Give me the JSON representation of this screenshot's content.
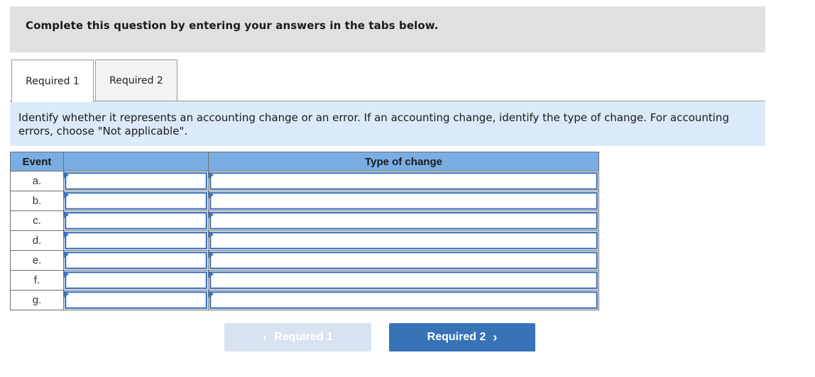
{
  "banner": {
    "text": "Complete this question by entering your answers in the tabs below."
  },
  "tabs": [
    {
      "label": "Required 1",
      "active": true
    },
    {
      "label": "Required 2",
      "active": false
    }
  ],
  "instructions": "Identify whether it represents an accounting change or an error. If an accounting change, identify the type of change. For accounting errors, choose \"Not applicable\".",
  "table": {
    "headers": [
      "Event",
      "",
      "Type of change"
    ],
    "rows": [
      {
        "event": "a.",
        "classification": "",
        "type_of_change": ""
      },
      {
        "event": "b.",
        "classification": "",
        "type_of_change": ""
      },
      {
        "event": "c.",
        "classification": "",
        "type_of_change": ""
      },
      {
        "event": "d.",
        "classification": "",
        "type_of_change": ""
      },
      {
        "event": "e.",
        "classification": "",
        "type_of_change": ""
      },
      {
        "event": "f.",
        "classification": "",
        "type_of_change": ""
      },
      {
        "event": "g.",
        "classification": "",
        "type_of_change": ""
      }
    ]
  },
  "navigation": {
    "prev": {
      "label": "Required 1",
      "icon": "chevron-left-icon",
      "glyph": "‹",
      "disabled": true
    },
    "next": {
      "label": "Required 2",
      "icon": "chevron-right-icon",
      "glyph": "›",
      "disabled": false
    }
  },
  "colors": {
    "banner_bg": "#e0e0e0",
    "instructions_bg": "#daeaf8",
    "table_header_bg": "#7aaee3",
    "input_border": "#4a78b8",
    "next_button_bg": "#3873b8",
    "prev_button_bg": "#d8e3f1"
  }
}
